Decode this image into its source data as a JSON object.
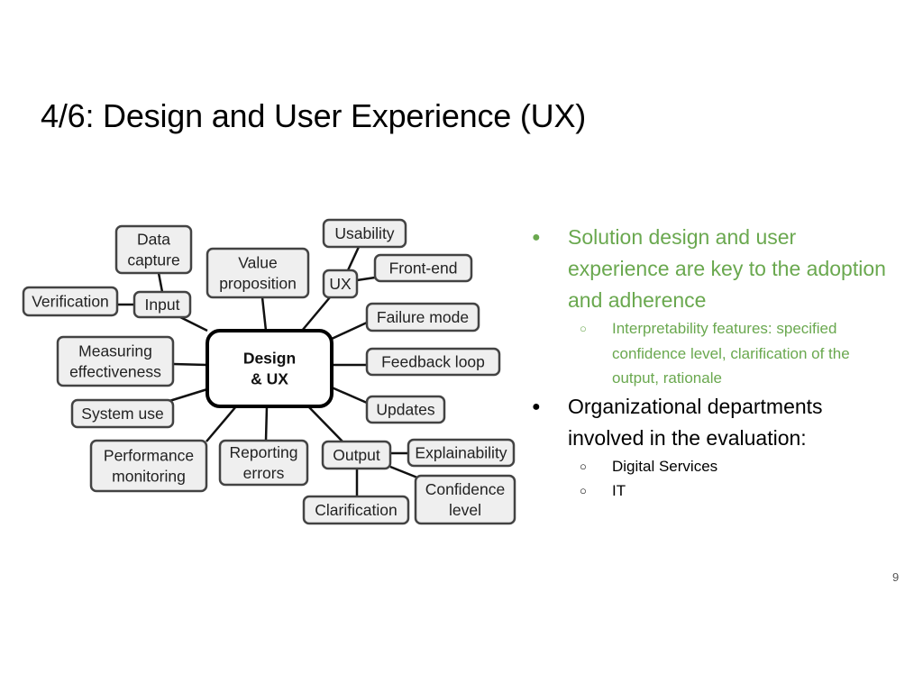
{
  "slide": {
    "title": "4/6: Design and User Experience (UX)",
    "page_number": "9",
    "accent_color": "#6aa84f"
  },
  "diagram": {
    "center": {
      "id": "center",
      "lines": [
        "Design",
        "& UX"
      ]
    },
    "nodes": [
      {
        "id": "data-capture",
        "lines": [
          "Data",
          "capture"
        ]
      },
      {
        "id": "value-proposition",
        "lines": [
          "Value",
          "proposition"
        ]
      },
      {
        "id": "usability",
        "lines": [
          "Usability"
        ]
      },
      {
        "id": "front-end",
        "lines": [
          "Front-end"
        ]
      },
      {
        "id": "ux",
        "lines": [
          "UX"
        ]
      },
      {
        "id": "verification",
        "lines": [
          "Verification"
        ]
      },
      {
        "id": "input",
        "lines": [
          "Input"
        ]
      },
      {
        "id": "failure-mode",
        "lines": [
          "Failure mode"
        ]
      },
      {
        "id": "measuring-effectiveness",
        "lines": [
          "Measuring",
          "effectiveness"
        ]
      },
      {
        "id": "feedback-loop",
        "lines": [
          "Feedback loop"
        ]
      },
      {
        "id": "system-use",
        "lines": [
          "System use"
        ]
      },
      {
        "id": "updates",
        "lines": [
          "Updates"
        ]
      },
      {
        "id": "performance-monitoring",
        "lines": [
          "Performance",
          "monitoring"
        ]
      },
      {
        "id": "reporting-errors",
        "lines": [
          "Reporting",
          "errors"
        ]
      },
      {
        "id": "output",
        "lines": [
          "Output"
        ]
      },
      {
        "id": "explainability",
        "lines": [
          "Explainability"
        ]
      },
      {
        "id": "clarification",
        "lines": [
          "Clarification"
        ]
      },
      {
        "id": "confidence-level",
        "lines": [
          "Confidence",
          "level"
        ]
      }
    ],
    "edges": [
      [
        "center",
        "input"
      ],
      [
        "center",
        "value-proposition"
      ],
      [
        "center",
        "ux"
      ],
      [
        "center",
        "failure-mode"
      ],
      [
        "center",
        "feedback-loop"
      ],
      [
        "center",
        "updates"
      ],
      [
        "center",
        "measuring-effectiveness"
      ],
      [
        "center",
        "system-use"
      ],
      [
        "center",
        "performance-monitoring"
      ],
      [
        "center",
        "reporting-errors"
      ],
      [
        "center",
        "output"
      ],
      [
        "input",
        "data-capture"
      ],
      [
        "input",
        "verification"
      ],
      [
        "ux",
        "usability"
      ],
      [
        "ux",
        "front-end"
      ],
      [
        "output",
        "explainability"
      ],
      [
        "output",
        "clarification"
      ],
      [
        "output",
        "confidence-level"
      ]
    ]
  },
  "bullets": [
    {
      "text": "Solution design and user experience are key to the adoption and adherence",
      "color": "green",
      "children": [
        {
          "text": "Interpretability features: specified confidence level, clarification of the output, rationale",
          "color": "green"
        }
      ]
    },
    {
      "text": "Organizational departments involved in the evaluation:",
      "color": "black",
      "children": [
        {
          "text": "Digital Services",
          "color": "black"
        },
        {
          "text": "IT",
          "color": "black"
        }
      ]
    }
  ],
  "bullet_glyphs": {
    "level1": "●",
    "level2": "○"
  }
}
